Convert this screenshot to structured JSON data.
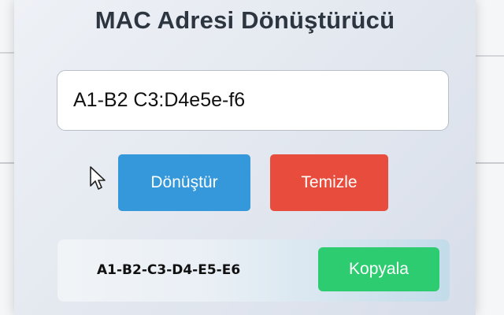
{
  "app": {
    "title": "MAC Adresi Dönüştürücü"
  },
  "input": {
    "value": "A1-B2 C3:D4e5e-f6"
  },
  "buttons": {
    "convert_label": "Dönüştür",
    "clear_label": "Temizle",
    "copy_label": "Kopyala"
  },
  "result": {
    "text": "A1-B2-C3-D4-E5-E6"
  },
  "icons": {
    "cursor": "mouse-pointer-icon"
  },
  "colors": {
    "convert": "#3498db",
    "clear": "#e74c3c",
    "copy": "#2ecc71",
    "title": "#2d3640"
  }
}
